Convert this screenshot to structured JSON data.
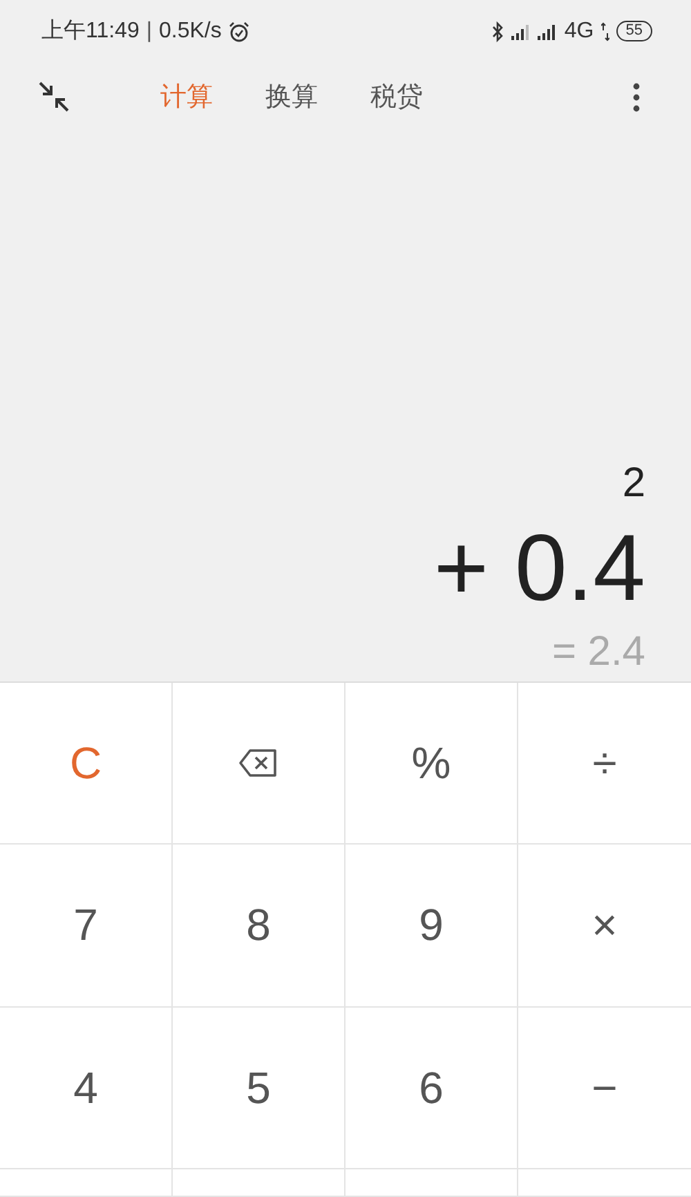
{
  "status_bar": {
    "time": "上午11:49",
    "separator": "|",
    "speed": "0.5K/s",
    "network": "4G",
    "battery": "55"
  },
  "tabs": [
    {
      "label": "计算",
      "selected": true
    },
    {
      "label": "换算",
      "selected": false
    },
    {
      "label": "税贷",
      "selected": false
    }
  ],
  "display": {
    "expression": [
      "2",
      "+ 0.4"
    ],
    "result": "= 2.4"
  },
  "keys": [
    {
      "kind": "text",
      "label": "C",
      "accent": true
    },
    {
      "kind": "backspace"
    },
    {
      "kind": "text",
      "label": "%",
      "accent": false
    },
    {
      "kind": "text",
      "label": "÷",
      "accent": false
    },
    {
      "kind": "text",
      "label": "7",
      "accent": false
    },
    {
      "kind": "text",
      "label": "8",
      "accent": false
    },
    {
      "kind": "text",
      "label": "9",
      "accent": false
    },
    {
      "kind": "text",
      "label": "×",
      "accent": false
    },
    {
      "kind": "text",
      "label": "4",
      "accent": false
    },
    {
      "kind": "text",
      "label": "5",
      "accent": false
    },
    {
      "kind": "text",
      "label": "6",
      "accent": false
    },
    {
      "kind": "text",
      "label": "−",
      "accent": false
    }
  ]
}
